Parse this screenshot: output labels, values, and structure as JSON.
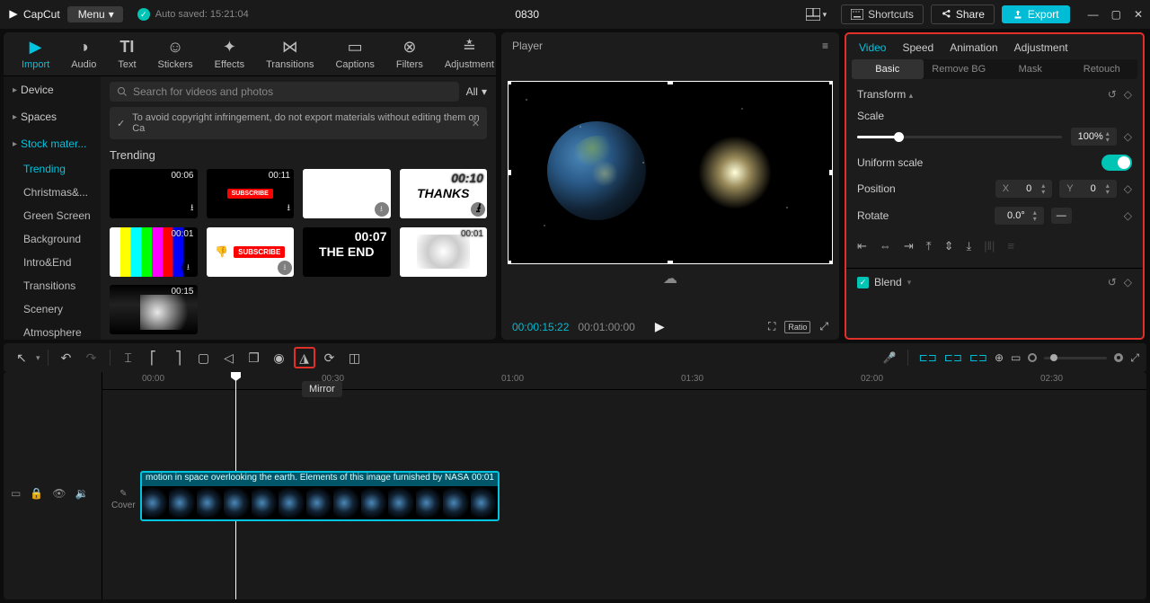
{
  "app": {
    "name": "CapCut",
    "menu": "Menu",
    "autosaved": "Auto saved: 15:21:04",
    "project": "0830"
  },
  "titlebar": {
    "shortcuts": "Shortcuts",
    "share": "Share",
    "export": "Export"
  },
  "topnav": [
    {
      "label": "Import",
      "active": true
    },
    {
      "label": "Audio"
    },
    {
      "label": "Text"
    },
    {
      "label": "Stickers"
    },
    {
      "label": "Effects"
    },
    {
      "label": "Transitions"
    },
    {
      "label": "Captions"
    },
    {
      "label": "Filters"
    },
    {
      "label": "Adjustment"
    }
  ],
  "search": {
    "placeholder": "Search for videos and photos",
    "all": "All"
  },
  "copyright": "To avoid copyright infringement, do not export materials without editing them on Ca",
  "leftnav": {
    "top": [
      {
        "label": "Device"
      },
      {
        "label": "Spaces"
      },
      {
        "label": "Stock mater...",
        "selected": true
      }
    ],
    "subs": [
      {
        "label": "Trending",
        "selected": true
      },
      {
        "label": "Christmas&..."
      },
      {
        "label": "Green Screen"
      },
      {
        "label": "Background"
      },
      {
        "label": "Intro&End"
      },
      {
        "label": "Transitions"
      },
      {
        "label": "Scenery"
      },
      {
        "label": "Atmosphere"
      }
    ]
  },
  "section_title": "Trending",
  "thumbs": [
    {
      "dur": "00:06"
    },
    {
      "dur": "00:11"
    },
    {
      "dur": ""
    },
    {
      "dur": "00:10",
      "text": "THANKS"
    },
    {
      "dur": "00:01"
    },
    {
      "dur": ""
    },
    {
      "dur": "00:07",
      "text": "THE END"
    },
    {
      "dur": "00:01"
    },
    {
      "dur": "00:15"
    }
  ],
  "player": {
    "title": "Player",
    "current": "00:00:15:22",
    "total": "00:01:00:00"
  },
  "inspector": {
    "tabs": [
      "Video",
      "Speed",
      "Animation",
      "Adjustment"
    ],
    "subtabs": [
      "Basic",
      "Remove BG",
      "Mask",
      "Retouch"
    ],
    "transform": "Transform",
    "scale_label": "Scale",
    "scale_value": "100%",
    "uniform": "Uniform scale",
    "position": "Position",
    "pos_x_label": "X",
    "pos_x": "0",
    "pos_y_label": "Y",
    "pos_y": "0",
    "rotate_label": "Rotate",
    "rotate_value": "0.0°",
    "blend": "Blend"
  },
  "tooltip": "Mirror",
  "ruler": [
    "00:00",
    "00:30",
    "01:00",
    "01:30",
    "02:00",
    "02:30"
  ],
  "clip": {
    "label": "motion in space overlooking the earth. Elements of this image furnished by NASA",
    "dur": "00:01"
  },
  "cover": "Cover"
}
